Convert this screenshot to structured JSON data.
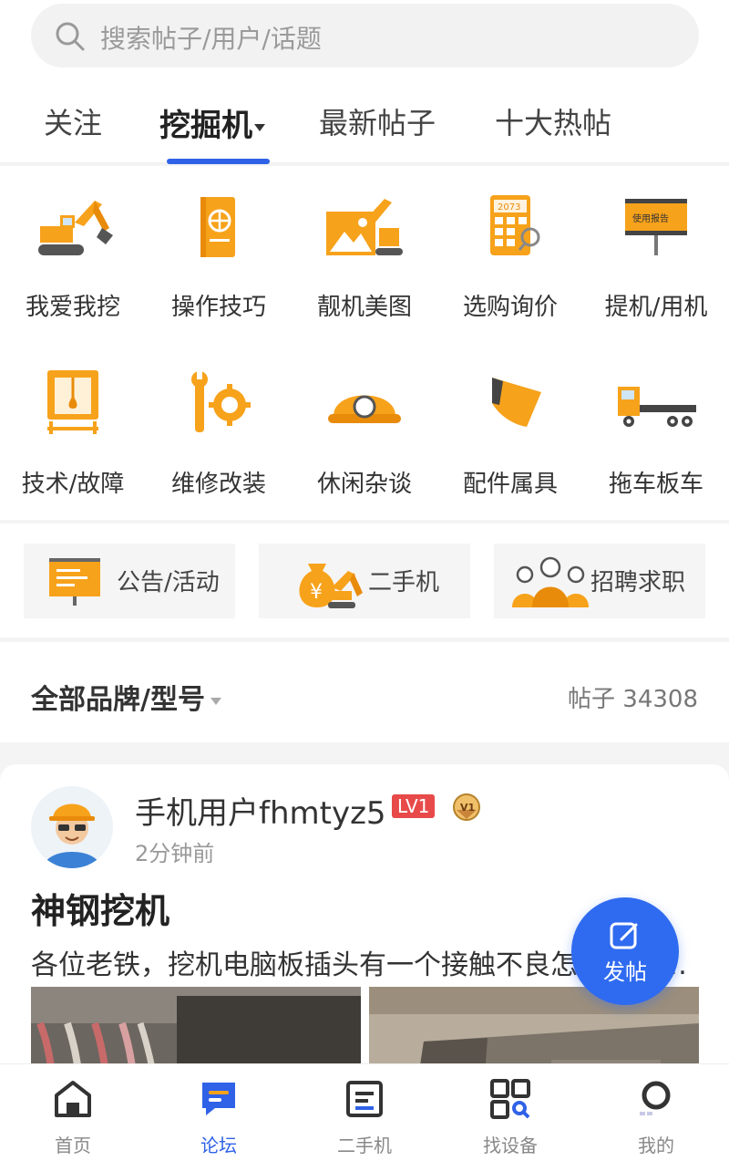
{
  "search": {
    "placeholder": "搜索帖子/用户/话题"
  },
  "tabs": [
    {
      "label": "关注"
    },
    {
      "label": "挖掘机"
    },
    {
      "label": "最新帖子"
    },
    {
      "label": "十大热帖"
    }
  ],
  "categories": [
    {
      "label": "我爱我挖",
      "icon": "excavator-icon"
    },
    {
      "label": "操作技巧",
      "icon": "book-icon"
    },
    {
      "label": "靓机美图",
      "icon": "photo-excavator-icon"
    },
    {
      "label": "选购询价",
      "icon": "calculator-icon"
    },
    {
      "label": "提机/用机",
      "icon": "report-sign-icon"
    },
    {
      "label": "技术/故障",
      "icon": "fuse-box-icon"
    },
    {
      "label": "维修改装",
      "icon": "wrench-gear-icon"
    },
    {
      "label": "休闲杂谈",
      "icon": "hard-hat-icon"
    },
    {
      "label": "配件属具",
      "icon": "bucket-icon"
    },
    {
      "label": "拖车板车",
      "icon": "flatbed-truck-icon"
    }
  ],
  "calculator_display": "2073",
  "report_sign_text": "使用报告",
  "quick_links": [
    {
      "label": "公告/活动",
      "icon": "notice-board-icon"
    },
    {
      "label": "二手机",
      "icon": "money-bag-excavator-icon"
    },
    {
      "label": "招聘求职",
      "icon": "people-group-icon"
    }
  ],
  "filter": {
    "brand_label": "全部品牌/型号",
    "post_count": "帖子 34308"
  },
  "post": {
    "username": "手机用户fhmtyz5",
    "level": "LV1",
    "medal": "V1",
    "time": "2分钟前",
    "title": "神钢挖机",
    "body": "各位老铁，挖机电脑板插头有一个接触不良怎么处理…"
  },
  "fab": {
    "label": "发帖"
  },
  "bottom_nav": [
    {
      "label": "首页",
      "icon": "home-icon",
      "active": false
    },
    {
      "label": "论坛",
      "icon": "forum-icon",
      "active": true
    },
    {
      "label": "二手机",
      "icon": "used-machine-icon",
      "active": false
    },
    {
      "label": "找设备",
      "icon": "find-equipment-icon",
      "active": false
    },
    {
      "label": "我的",
      "icon": "profile-icon",
      "active": false
    }
  ],
  "colors": {
    "accent": "#2f62e7",
    "icon_orange": "#f7a21b",
    "level_badge": "#e84a4a",
    "fab": "#2f6bf0"
  }
}
